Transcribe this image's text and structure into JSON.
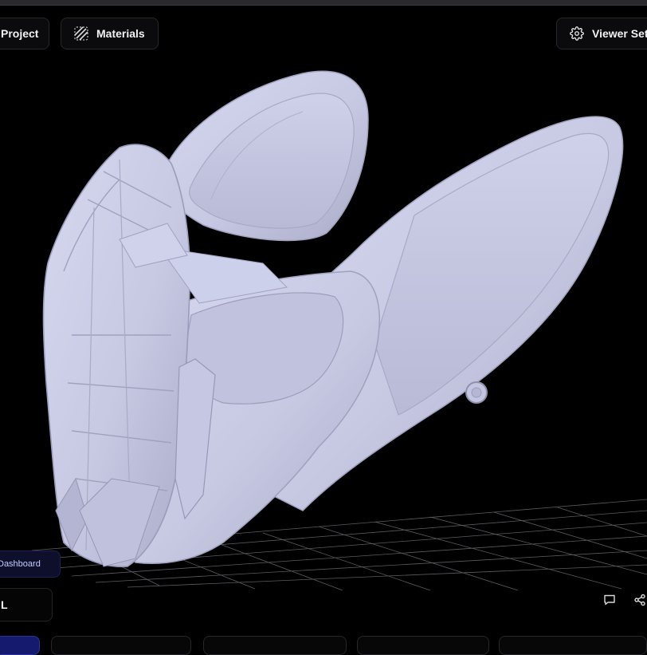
{
  "toolbar": {
    "project_label": "Project",
    "materials_label": "Materials",
    "viewer_settings_label": "Viewer Settings",
    "icons": {
      "materials": "hatch-texture-icon",
      "viewer_settings": "gear-icon"
    }
  },
  "viewport": {
    "model": "mask-3d-model",
    "model_color": "#c9cbe6",
    "grid": true
  },
  "left_panel": {
    "dashboard_label": "Dashboard",
    "model_name": "L"
  },
  "right_tools": {
    "icons": [
      "comment-icon",
      "share-icon"
    ]
  },
  "colors": {
    "background": "#000000",
    "panel": "#0b0b0d",
    "border": "#26262b",
    "accent": "#151a6e"
  }
}
